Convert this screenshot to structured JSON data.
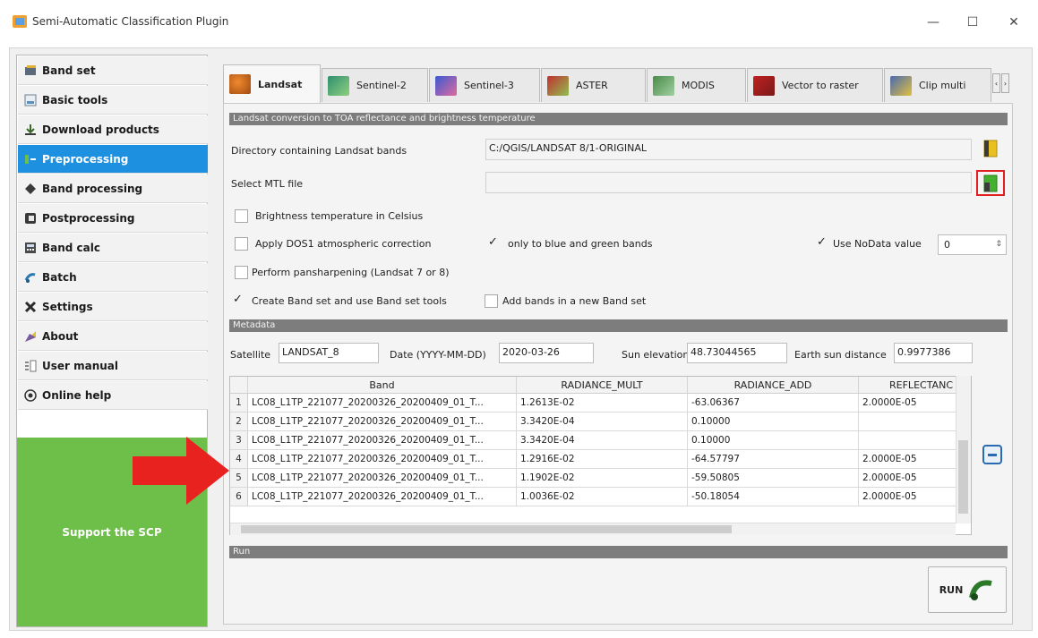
{
  "window": {
    "title": "Semi-Automatic Classification Plugin",
    "min_glyph": "—",
    "max_glyph": "☐",
    "close_glyph": "✕"
  },
  "sidebar": {
    "items": [
      {
        "label": "Band set",
        "icon": "band-set-icon"
      },
      {
        "label": "Basic tools",
        "icon": "basic-tools-icon"
      },
      {
        "label": "Download products",
        "icon": "download-icon"
      },
      {
        "label": "Preprocessing",
        "icon": "preprocessing-icon",
        "active": true
      },
      {
        "label": "Band processing",
        "icon": "band-processing-icon"
      },
      {
        "label": "Postprocessing",
        "icon": "postprocessing-icon"
      },
      {
        "label": "Band calc",
        "icon": "calculator-icon"
      },
      {
        "label": "Batch",
        "icon": "batch-icon"
      },
      {
        "label": "Settings",
        "icon": "settings-icon"
      },
      {
        "label": "About",
        "icon": "about-icon"
      },
      {
        "label": "User manual",
        "icon": "manual-icon"
      },
      {
        "label": "Online help",
        "icon": "help-icon"
      }
    ],
    "support_label": "Support the SCP"
  },
  "tabs": [
    {
      "label": "Landsat",
      "active": true
    },
    {
      "label": "Sentinel-2"
    },
    {
      "label": "Sentinel-3"
    },
    {
      "label": "ASTER"
    },
    {
      "label": "MODIS"
    },
    {
      "label": "Vector to raster"
    },
    {
      "label": "Clip multiple"
    }
  ],
  "landsat": {
    "section_title": "Landsat conversion to TOA reflectance and brightness temperature",
    "dir_label": "Directory containing Landsat bands",
    "dir_value": "C:/QGIS/LANDSAT 8/1-ORIGINAL",
    "mtl_label": "Select MTL file",
    "mtl_value": "",
    "brightness_label": "Brightness temperature in Celsius",
    "dos1_label": "Apply DOS1 atmospheric correction",
    "blue_green_label": "only to blue and green bands",
    "nodata_label": "Use NoData value",
    "nodata_value": "0",
    "pansharpen_label": "Perform pansharpening (Landsat 7 or 8)",
    "create_bandset_label": "Create Band set and use Band set tools",
    "add_bands_label": "Add bands in a new Band set"
  },
  "metadata": {
    "section_title": "Metadata",
    "satellite_label": "Satellite",
    "satellite_value": "LANDSAT_8",
    "date_label": "Date (YYYY-MM-DD)",
    "date_value": "2020-03-26",
    "sun_elev_label": "Sun elevation",
    "sun_elev_value": "48.73044565",
    "earth_sun_label": "Earth sun distance",
    "earth_sun_value": "0.9977386",
    "columns": [
      "Band",
      "RADIANCE_MULT",
      "RADIANCE_ADD",
      "REFLECTANC"
    ],
    "rows": [
      {
        "n": "1",
        "band": "LC08_L1TP_221077_20200326_20200409_01_T...",
        "mult": "1.2613E-02",
        "add": "-63.06367",
        "refl": "2.0000E-05"
      },
      {
        "n": "2",
        "band": "LC08_L1TP_221077_20200326_20200409_01_T...",
        "mult": "3.3420E-04",
        "add": "0.10000",
        "refl": ""
      },
      {
        "n": "3",
        "band": "LC08_L1TP_221077_20200326_20200409_01_T...",
        "mult": "3.3420E-04",
        "add": "0.10000",
        "refl": ""
      },
      {
        "n": "4",
        "band": "LC08_L1TP_221077_20200326_20200409_01_T...",
        "mult": "1.2916E-02",
        "add": "-64.57797",
        "refl": "2.0000E-05"
      },
      {
        "n": "5",
        "band": "LC08_L1TP_221077_20200326_20200409_01_T...",
        "mult": "1.1902E-02",
        "add": "-59.50805",
        "refl": "2.0000E-05"
      },
      {
        "n": "6",
        "band": "LC08_L1TP_221077_20200326_20200409_01_T...",
        "mult": "1.0036E-02",
        "add": "-50.18054",
        "refl": "2.0000E-05"
      }
    ]
  },
  "run": {
    "section_title": "Run",
    "button_label": "RUN"
  },
  "colors": {
    "accent": "#1e90e0",
    "support_bg": "#6dbf4a",
    "highlight": "#e02020",
    "arrow": "#e8231f"
  }
}
